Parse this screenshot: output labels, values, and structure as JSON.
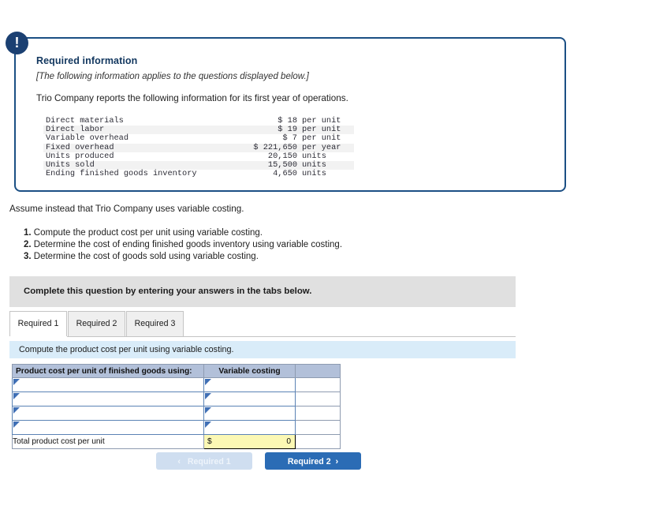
{
  "info_card": {
    "icon": "exclamation-icon",
    "title": "Required information",
    "note": "[The following information applies to the questions displayed below.]",
    "lead": "Trio Company reports the following information for its first year of operations.",
    "figures": [
      {
        "label": "Direct materials",
        "amount": "$ 18",
        "unit": "per unit"
      },
      {
        "label": "Direct labor",
        "amount": "$ 19",
        "unit": "per unit"
      },
      {
        "label": "Variable overhead",
        "amount": "$ 7",
        "unit": "per unit"
      },
      {
        "label": "Fixed overhead",
        "amount": "$ 221,650",
        "unit": "per year"
      },
      {
        "label": "Units produced",
        "amount": "20,150",
        "unit": "units"
      },
      {
        "label": "Units sold",
        "amount": "15,500",
        "unit": "units"
      },
      {
        "label": "Ending finished goods inventory",
        "amount": "4,650",
        "unit": "units"
      }
    ]
  },
  "question": {
    "assume": "Assume instead that Trio Company uses variable costing.",
    "requirements": [
      {
        "num": "1.",
        "text": "Compute the product cost per unit using variable costing."
      },
      {
        "num": "2.",
        "text": "Determine the cost of ending finished goods inventory using variable costing."
      },
      {
        "num": "3.",
        "text": "Determine the cost of goods sold using variable costing."
      }
    ]
  },
  "complete_banner": "Complete this question by entering your answers in the tabs below.",
  "tabs": [
    {
      "label": "Required 1",
      "active": true
    },
    {
      "label": "Required 2",
      "active": false
    },
    {
      "label": "Required 3",
      "active": false
    }
  ],
  "sub_banner": "Compute the product cost per unit using variable costing.",
  "answer_grid": {
    "headers": [
      "Product cost per unit of finished goods using:",
      "Variable costing",
      ""
    ],
    "input_rows": [
      {
        "label": "",
        "value": ""
      },
      {
        "label": "",
        "value": ""
      },
      {
        "label": "",
        "value": ""
      },
      {
        "label": "",
        "value": ""
      }
    ],
    "total_row": {
      "label": "Total product cost per unit",
      "currency": "$",
      "value": "0"
    }
  },
  "navigation": {
    "prev_label": "Required 1",
    "prev_chevron": "‹",
    "next_label": "Required 2",
    "next_chevron": "›"
  },
  "colors": {
    "card_border": "#1b4f84",
    "icon_bg": "#1b4072",
    "title_text": "#12375f",
    "banner_gray": "#e0e0e0",
    "banner_blue": "#d9ecf9",
    "grid_header": "#b2c0d9",
    "input_border": "#5b83b5",
    "total_yellow": "#fbf8b4",
    "btn_primary": "#2b6cb5",
    "btn_disabled": "#cfdef0"
  }
}
